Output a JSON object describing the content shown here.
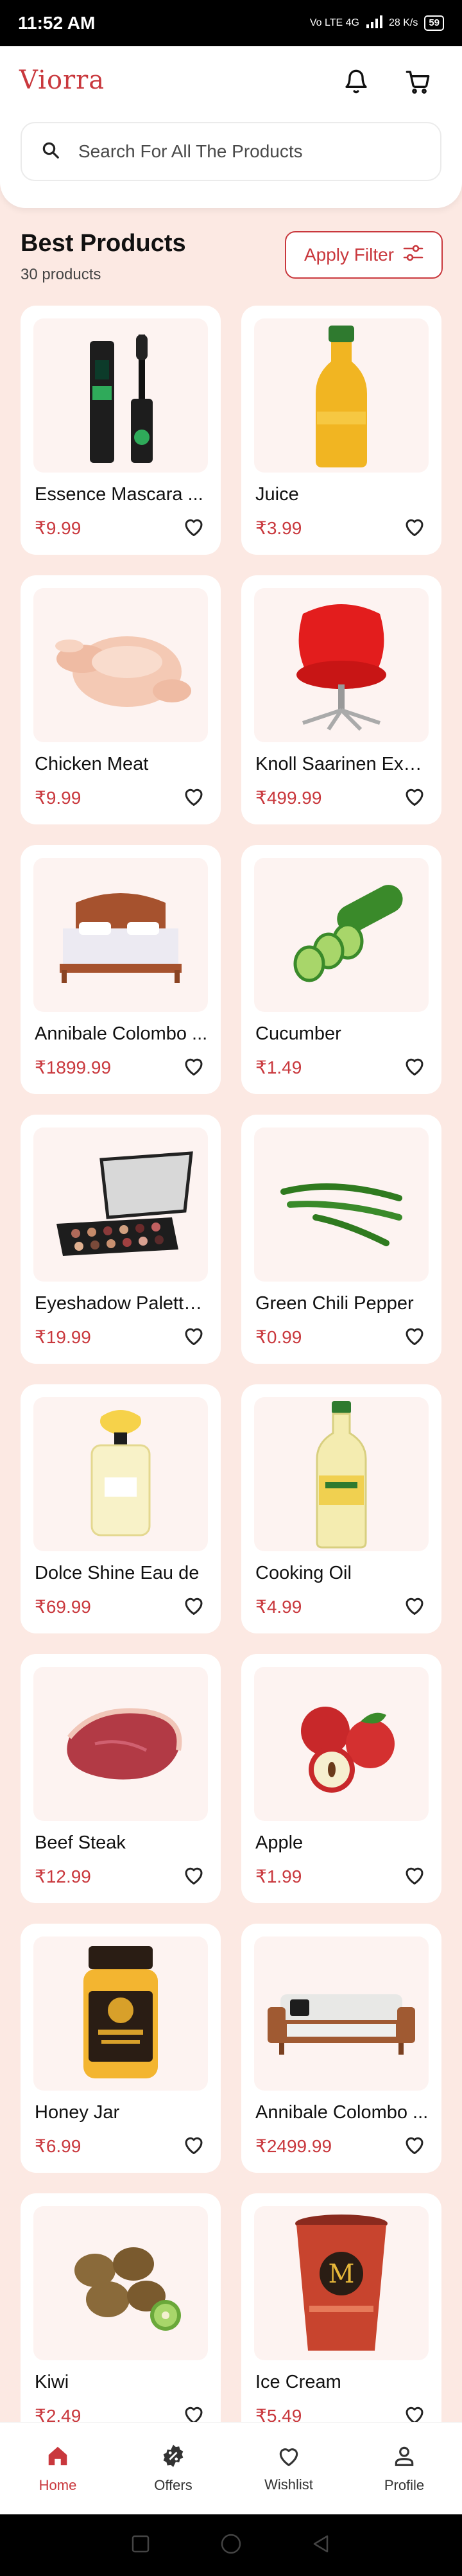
{
  "status_bar": {
    "time": "11:52 AM",
    "network": "Vo LTE 4G",
    "speed": "28 K/s",
    "battery": "59"
  },
  "header": {
    "logo": "Viorra",
    "search_placeholder": "Search For All The Products"
  },
  "section": {
    "title": "Best Products",
    "count": "30 products",
    "filter_label": "Apply Filter"
  },
  "products": [
    {
      "name": "Essence Mascara ...",
      "price": "₹9.99",
      "icon": "mascara-image"
    },
    {
      "name": "Juice",
      "price": "₹3.99",
      "icon": "juice-bottle-image"
    },
    {
      "name": "Chicken Meat",
      "price": "₹9.99",
      "icon": "chicken-image"
    },
    {
      "name": "Knoll Saarinen Exe...",
      "price": "₹499.99",
      "icon": "red-chair-image"
    },
    {
      "name": "Annibale Colombo ...",
      "price": "₹1899.99",
      "icon": "bed-image"
    },
    {
      "name": "Cucumber",
      "price": "₹1.49",
      "icon": "cucumber-image"
    },
    {
      "name": "Eyeshadow Palette...",
      "price": "₹19.99",
      "icon": "eyeshadow-palette-image"
    },
    {
      "name": "Green Chili Pepper",
      "price": "₹0.99",
      "icon": "chili-pepper-image"
    },
    {
      "name": "Dolce Shine Eau de",
      "price": "₹69.99",
      "icon": "perfume-image"
    },
    {
      "name": "Cooking Oil",
      "price": "₹4.99",
      "icon": "oil-bottle-image"
    },
    {
      "name": "Beef Steak",
      "price": "₹12.99",
      "icon": "steak-image"
    },
    {
      "name": "Apple",
      "price": "₹1.99",
      "icon": "apple-image"
    },
    {
      "name": "Honey Jar",
      "price": "₹6.99",
      "icon": "honey-jar-image"
    },
    {
      "name": "Annibale Colombo ...",
      "price": "₹2499.99",
      "icon": "sofa-image"
    },
    {
      "name": "Kiwi",
      "price": "₹2.49",
      "icon": "kiwi-image"
    },
    {
      "name": "Ice Cream",
      "price": "₹5.49",
      "icon": "ice-cream-image"
    }
  ],
  "nav": [
    {
      "label": "Home",
      "icon": "home-icon",
      "active": true
    },
    {
      "label": "Offers",
      "icon": "offers-icon",
      "active": false
    },
    {
      "label": "Wishlist",
      "icon": "heart-icon",
      "active": false
    },
    {
      "label": "Profile",
      "icon": "profile-icon",
      "active": false
    }
  ],
  "colors": {
    "accent": "#c9383d",
    "background": "#fce9e3",
    "card": "#ffffff",
    "image_bg": "#fdf3f1"
  }
}
